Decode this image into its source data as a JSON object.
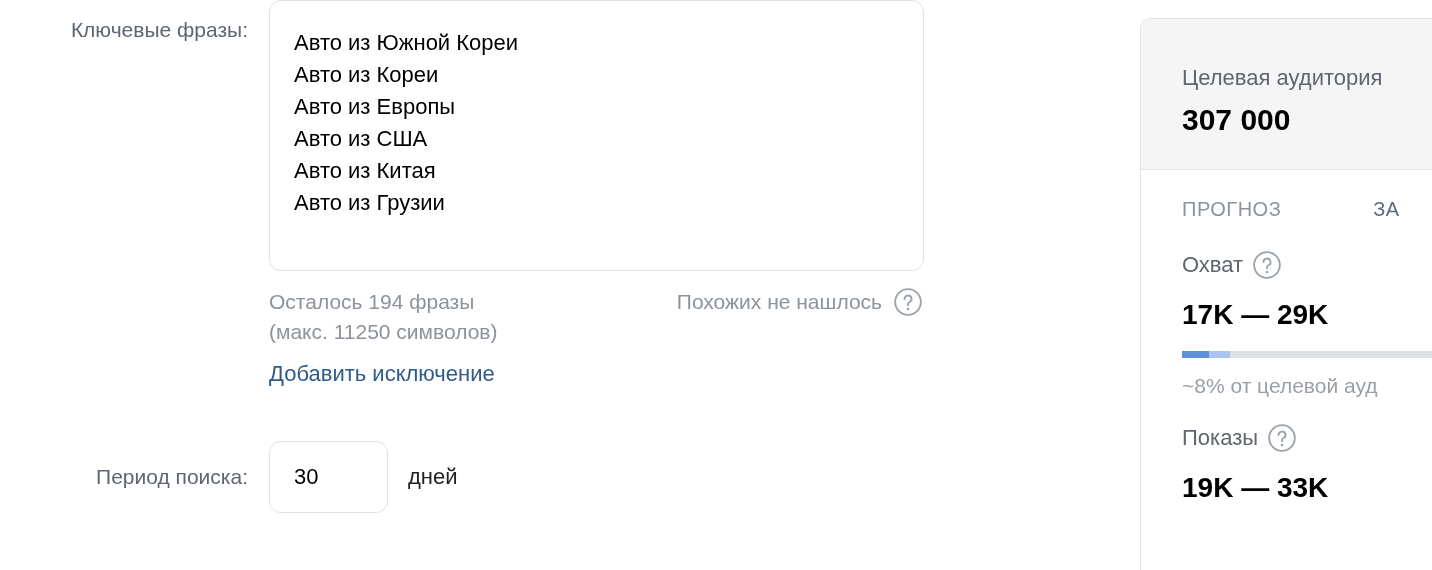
{
  "keywords": {
    "label": "Ключевые фразы:",
    "phrases": [
      "Авто из Южной Кореи",
      "Авто из Кореи",
      "Авто из Европы",
      "Авто из США",
      "Авто из Китая",
      "Авто из Грузии"
    ],
    "remaining": "Осталось 194 фразы\n(макс. 11250 символов)",
    "similar": "Похожих не нашлось",
    "add_exclusion": "Добавить исключение"
  },
  "period": {
    "label": "Период поиска:",
    "value": "30",
    "unit": "дней"
  },
  "panel": {
    "audience_label": "Целевая аудитория",
    "audience_value": "307 000",
    "forecast_label": "ПРОГНОЗ",
    "forecast_period": "ЗА",
    "metrics": [
      {
        "label": "Охват",
        "value": "17K — 29K",
        "bar": [
          {
            "level": 0.09
          },
          {
            "level": 0.16
          }
        ],
        "caption": "~8% от целевой ауд"
      },
      {
        "label": "Показы",
        "value": "19K — 33K"
      }
    ]
  }
}
